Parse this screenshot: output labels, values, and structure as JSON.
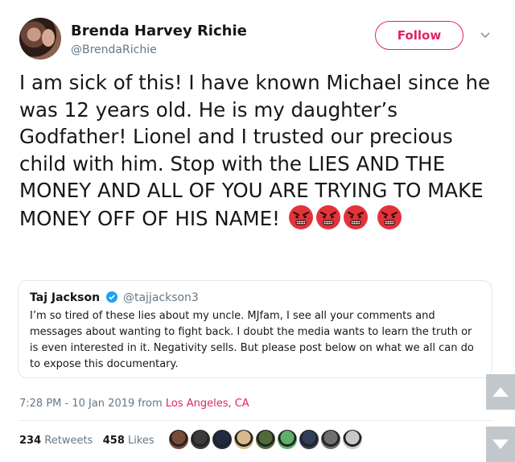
{
  "author": {
    "name": "Brenda Harvey Richie",
    "handle": "@BrendaRichie",
    "avatar_icon": "profile-photo"
  },
  "follow_button": {
    "label": "Follow",
    "color": "#e0245e"
  },
  "menu_icon": "chevron-down-icon",
  "tweet": {
    "text": "I am sick of this! I have known Michael since he was 12 years old. He is my daughter’s Godfather! Lionel and I trusted our precious child with him. Stop with the LIES AND THE MONEY AND ALL OF YOU ARE TRYING TO MAKE MONEY OFF OF HIS NAME!",
    "emoji_icon": "angry-face-icon",
    "emoji_count": 4
  },
  "quoted_tweet": {
    "name": "Taj Jackson",
    "verified_icon": "verified-badge-icon",
    "handle": "@tajjackson3",
    "text": "I’m so tired of these lies about my uncle. MJfam, I see all your comments and messages about wanting to fight back. I doubt the media wants to learn the truth or is even interested in it. Negativity sells. But please post below on what we all can do to expose this documentary."
  },
  "meta": {
    "timestamp": "7:28 PM - 10 Jan 2019",
    "from": "from",
    "location": "Los Angeles, CA"
  },
  "stats": {
    "retweets_count": "234",
    "retweets_label": "Retweets",
    "likes_count": "458",
    "likes_label": "Likes"
  },
  "likers": [
    "#7a4a3a",
    "#3b3b3b",
    "#1f2a44",
    "#d9b98a",
    "#4f6b3a",
    "#5fae6a",
    "#2f3f56",
    "#6f6f6f",
    "#c8c8c8"
  ],
  "scroll": {
    "up_icon": "scroll-up-icon",
    "down_icon": "scroll-down-icon"
  }
}
